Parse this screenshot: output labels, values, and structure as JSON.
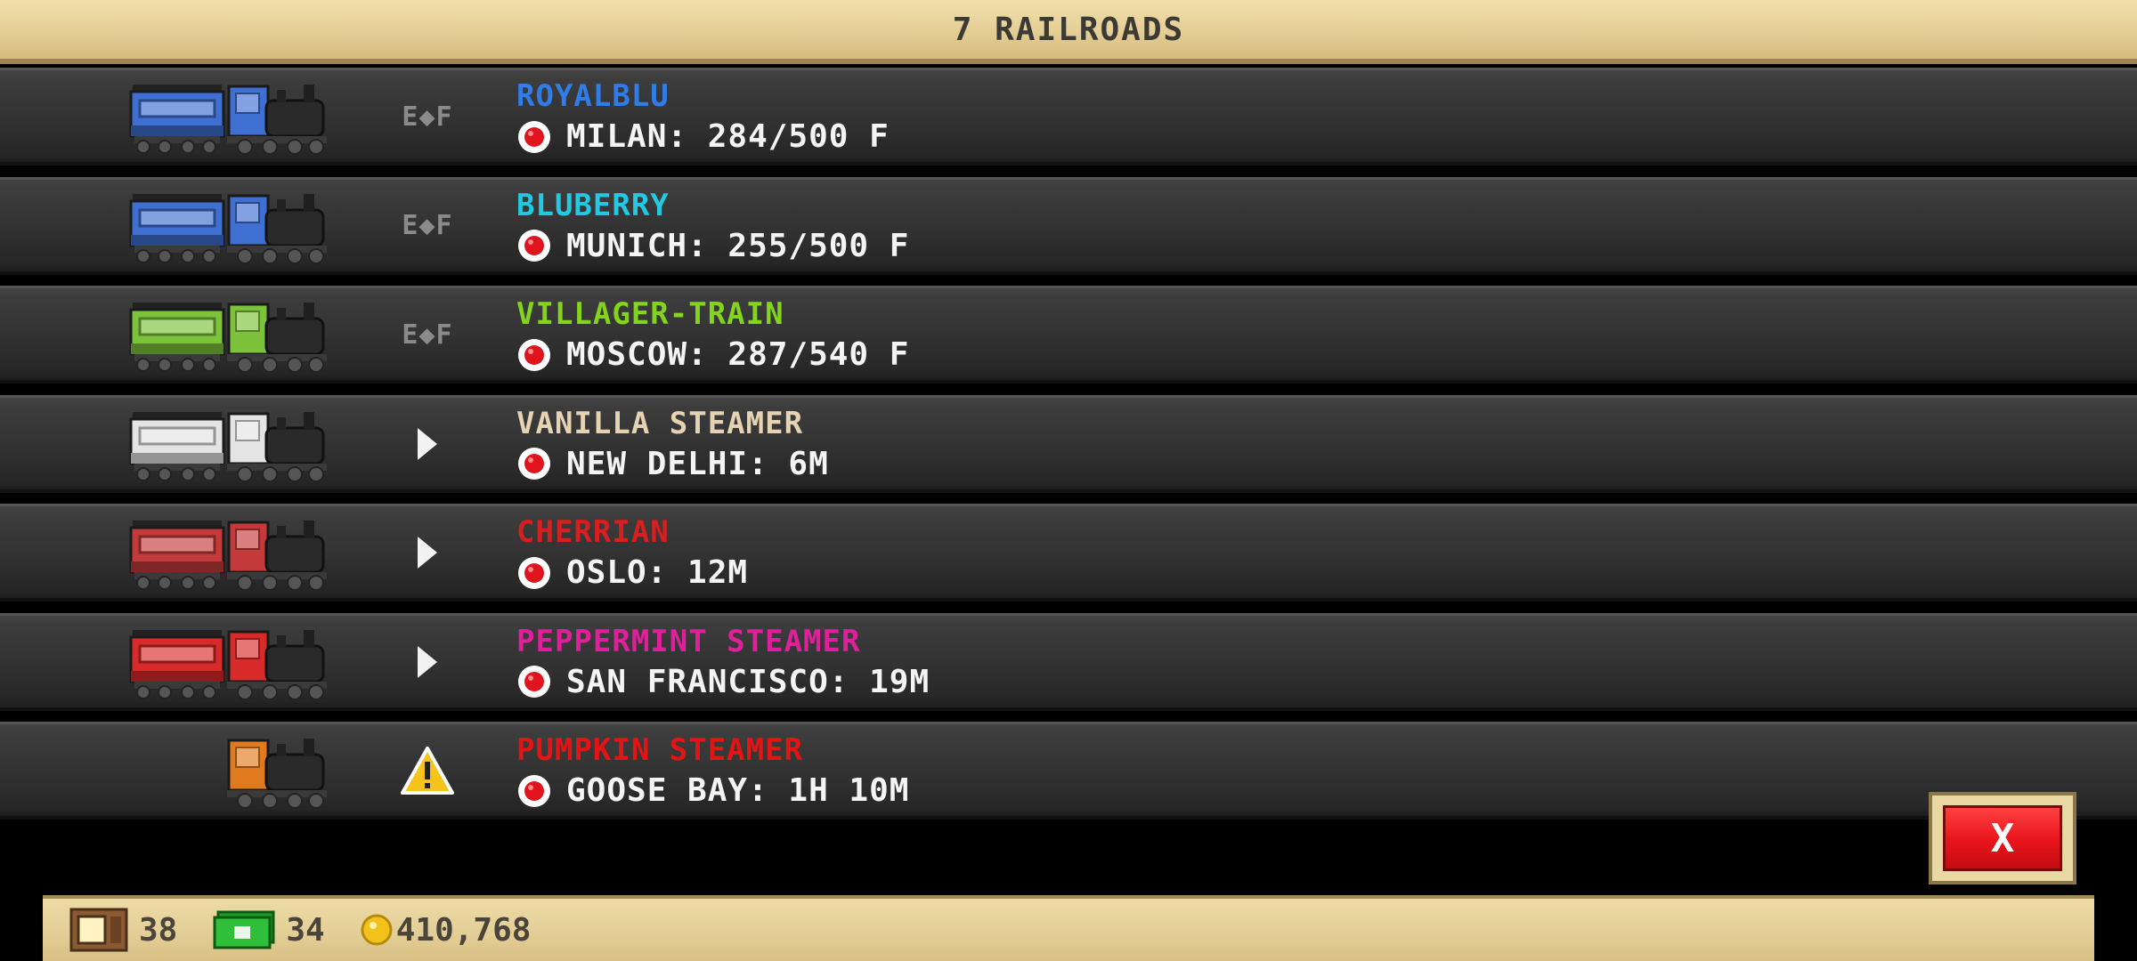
{
  "header": {
    "title": "7 RAILROADS"
  },
  "status_labels": {
    "ef": "E◆F"
  },
  "railroads": [
    {
      "name": "ROYALBLU",
      "name_color": "#2f7de8",
      "destination": "MILAN: 284/500 F",
      "status": "ef",
      "train_color": "#3f6fd0",
      "has_tender": true
    },
    {
      "name": "BLUBERRY",
      "name_color": "#22c9e2",
      "destination": "MUNICH: 255/500 F",
      "status": "ef",
      "train_color": "#3f6fd0",
      "has_tender": true
    },
    {
      "name": "VILLAGER-TRAIN",
      "name_color": "#82d41c",
      "destination": "MOSCOW: 287/540 F",
      "status": "ef",
      "train_color": "#7cc23a",
      "has_tender": true
    },
    {
      "name": "VANILLA STEAMER",
      "name_color": "#e6d3b4",
      "destination": "NEW DELHI: 6M",
      "status": "play",
      "train_color": "#e4e4e4",
      "has_tender": true
    },
    {
      "name": "CHERRIAN",
      "name_color": "#d81e1e",
      "destination": "OSLO: 12M",
      "status": "play",
      "train_color": "#c43a3a",
      "has_tender": true
    },
    {
      "name": "PEPPERMINT STEAMER",
      "name_color": "#e0209a",
      "destination": "SAN FRANCISCO: 19M",
      "status": "play",
      "train_color": "#d92a2a",
      "has_tender": true
    },
    {
      "name": "PUMPKIN STEAMER",
      "name_color": "#e21414",
      "destination": "GOOSE BAY: 1H 10M",
      "status": "warning",
      "train_color": "#e07a1e",
      "has_tender": false
    }
  ],
  "close_button": {
    "label": "X"
  },
  "footer": {
    "cars": "38",
    "cash": "34",
    "coins": "410,768"
  }
}
